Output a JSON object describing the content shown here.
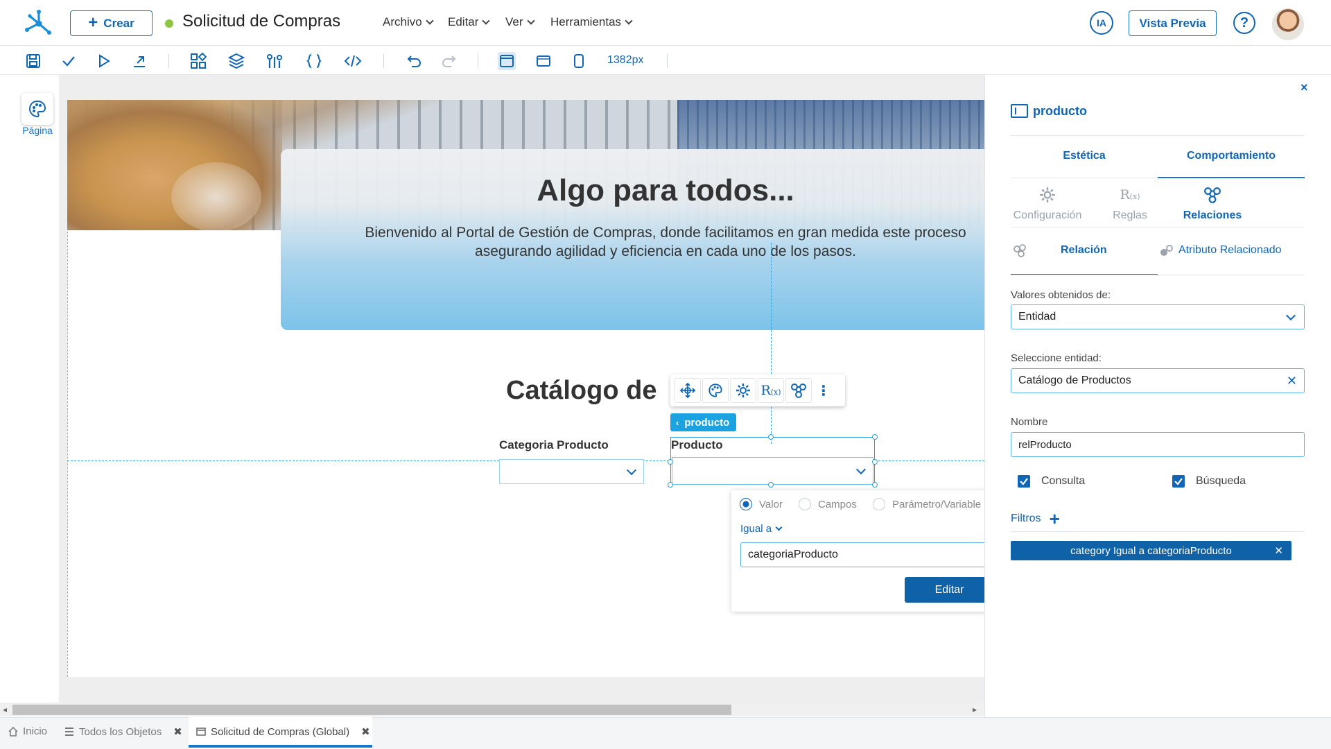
{
  "header": {
    "create_label": "Crear",
    "title": "Solicitud de Compras",
    "status_color": "#8dc63f",
    "menus": [
      "Archivo",
      "Editar",
      "Ver",
      "Herramientas"
    ],
    "ia_label": "IA",
    "preview_label": "Vista Previa",
    "help_label": "?"
  },
  "toolbar": {
    "icons": [
      "save-icon",
      "check-icon",
      "play-icon",
      "export-icon",
      "components-icon",
      "layers-icon",
      "data-icon",
      "braces-icon",
      "code-icon",
      "undo-icon",
      "redo-icon",
      "desktop-icon",
      "tablet-icon",
      "mobile-icon"
    ],
    "width_label": "1382px"
  },
  "left": {
    "page_label": "Página"
  },
  "canvas": {
    "hero_title": "Algo para todos...",
    "hero_text_line1": "Bienvenido al Portal de Gestión de Compras, donde facilitamos en gran medida este proceso",
    "hero_text_line2": "asegurando agilidad y eficiencia en cada uno de los pasos.",
    "catalog_title": "Catálogo de",
    "label_category": "Categoria Producto",
    "label_product": "Producto",
    "component_tag": "producto"
  },
  "filter_popup": {
    "radio_options": [
      "Valor",
      "Campos",
      "Parámetro/Variable"
    ],
    "selected_radio": "Valor",
    "operator": "Igual a",
    "value": "categoriaProducto",
    "edit_label": "Editar"
  },
  "panel": {
    "close_label": "×",
    "component_name": "producto",
    "tabs": [
      "Estética",
      "Comportamiento"
    ],
    "active_tab": "Comportamiento",
    "sub_tabs": [
      "Configuración",
      "Reglas",
      "Relaciones"
    ],
    "active_sub_tab": "Relaciones",
    "rel_tabs": [
      "Relación",
      "Atributo Relacionado"
    ],
    "active_rel_tab": "Relación",
    "values_from_label": "Valores obtenidos de:",
    "values_from_value": "Entidad",
    "entity_label": "Seleccione entidad:",
    "entity_value": "Catálogo de Productos",
    "name_label": "Nombre",
    "name_value": "relProducto",
    "check_query": "Consulta",
    "check_search": "Búsqueda",
    "filters_label": "Filtros",
    "filter_chip": "category Igual a categoriaProducto",
    "accent_color": "#1165b5"
  },
  "bottom_tabs": [
    {
      "label": "Inicio"
    },
    {
      "label": "Todos los Objetos"
    },
    {
      "label": "Solicitud de Compras (Global)"
    }
  ]
}
